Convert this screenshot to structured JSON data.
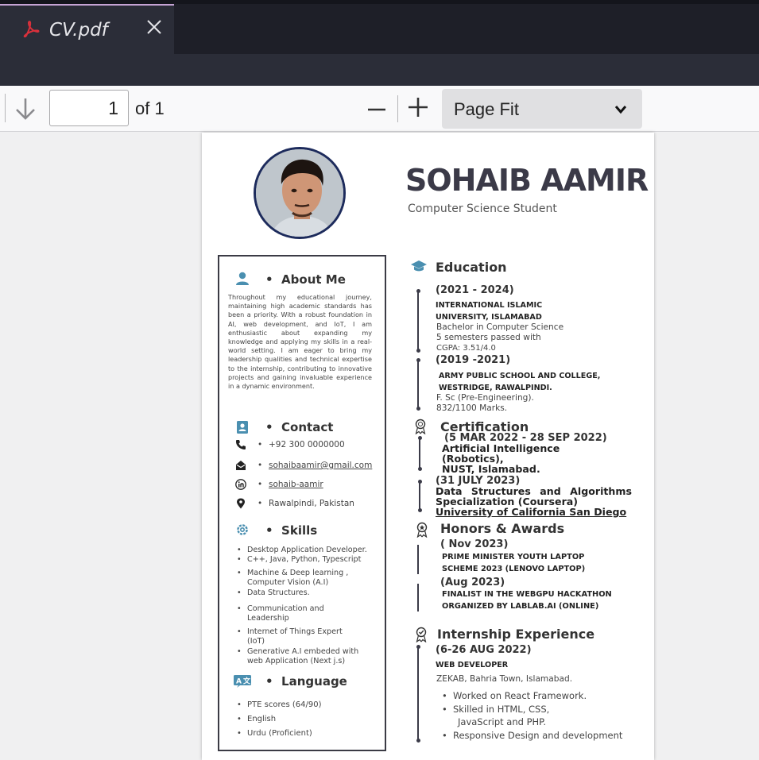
{
  "tab": {
    "title": "CV.pdf",
    "icon": "pdf-icon"
  },
  "toolbar": {
    "page_number": "1",
    "page_of": "of 1",
    "zoom_value": "Page Fit"
  },
  "cv": {
    "name": "SOHAIB AAMIR",
    "subtitle": "Computer Science Student",
    "about": {
      "title": "About Me",
      "text": "Throughout my educational journey, maintaining high academic standards has been a priority. With a robust foundation in AI, web development, and IoT, I am enthusiastic about expanding my knowledge and applying my skills in a real-world setting. I am eager to bring my leadership qualities and technical expertise to the internship, contributing to innovative projects and gaining invaluable experience in a dynamic environment."
    },
    "contact": {
      "title": "Contact",
      "phone": "+92 300 0000000",
      "email": "sohaibaamir@gmail.com",
      "linkedin": "sohaib-aamir",
      "location": "Rawalpindi, Pakistan"
    },
    "skills": {
      "title": "Skills",
      "items": [
        "Desktop Application Developer.",
        "C++, Java, Python, Typescript",
        "Machine & Deep learning ,",
        "Computer Vision (A.I)",
        "Data Structures.",
        "Communication and",
        "Leadership",
        "Internet of Things Expert",
        "(IoT)",
        "Generative A.I embeded with",
        "web Application (Next j.s)"
      ]
    },
    "language": {
      "title": "Language",
      "items": [
        "PTE scores (64/90)",
        "English",
        "Urdu (Proficient)"
      ]
    },
    "education": {
      "title": "Education",
      "entries": [
        {
          "date": "(2021 - 2024)",
          "org1": "INTERNATIONAL ISLAMIC",
          "org2": "UNIVERSITY, ISLAMABAD",
          "l1": "Bachelor in Computer Science",
          "l2": "5 semesters passed with",
          "l3": "CGPA: 3.51/4.0"
        },
        {
          "date": "(2019 -2021)",
          "org1": "ARMY PUBLIC SCHOOL AND COLLEGE,",
          "org2": "WESTRIDGE, RAWALPINDI.",
          "l1": "F. Sc (Pre-Engineering).",
          "l2": "832/1100 Marks."
        }
      ]
    },
    "certification": {
      "title": "Certification",
      "entries": [
        {
          "date": "(5 MAR 2022 - 28 SEP 2022)",
          "l1": "Artificial Intelligence",
          "l2": "(Robotics),",
          "l3": "NUST, Islamabad."
        },
        {
          "date": "(31 JULY 2023)",
          "l1": "Data Structures and Algorithms",
          "l2": "Specialization (Coursera)",
          "l3": "University of California San Diego"
        }
      ]
    },
    "honors": {
      "title": "Honors & Awards",
      "entries": [
        {
          "date": "( Nov 2023)",
          "l1": "PRIME MINISTER YOUTH LAPTOP",
          "l2": "SCHEME 2023 (LENOVO LAPTOP)"
        },
        {
          "date": "(Aug 2023)",
          "l1": "FINALIST  IN THE WEBGPU HACKATHON",
          "l2": "ORGANIZED BY LABLAB.AI (ONLINE)"
        }
      ]
    },
    "internship": {
      "title": "Internship Experience",
      "date": "(6-26 AUG 2022)",
      "role": "WEB DEVELOPER",
      "company": "ZEKAB, Bahria Town, Islamabad.",
      "items": [
        "Worked on React Framework.",
        "Skilled in HTML, CSS,",
        "JavaScript and PHP.",
        "Responsive Design and development"
      ]
    }
  },
  "colors": {
    "accent": "#4a8fb0",
    "dark": "#3b3a48",
    "tab_bg": "#2b2d38",
    "pdf_red": "#d9303b"
  }
}
